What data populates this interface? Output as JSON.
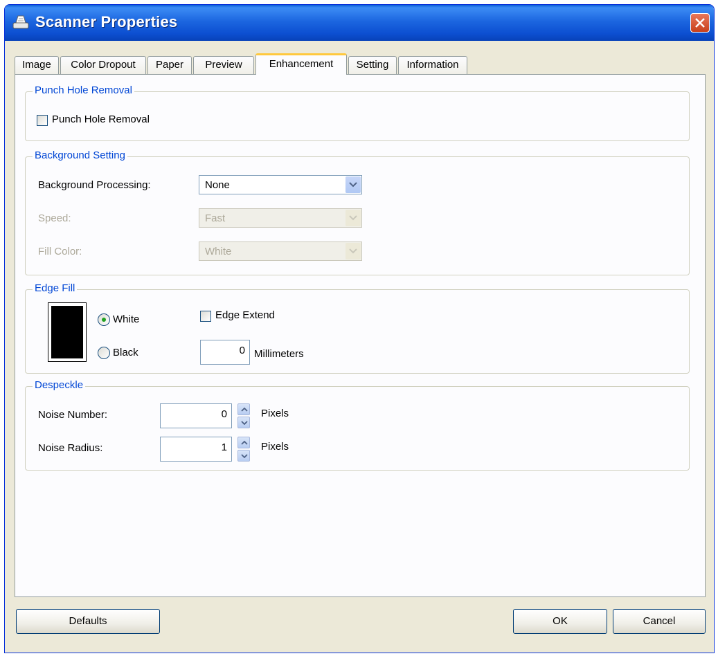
{
  "window": {
    "title": "Scanner Properties"
  },
  "tabs": [
    {
      "label": "Image"
    },
    {
      "label": "Color Dropout"
    },
    {
      "label": "Paper"
    },
    {
      "label": "Preview"
    },
    {
      "label": "Enhancement"
    },
    {
      "label": "Setting"
    },
    {
      "label": "Information"
    }
  ],
  "active_tab": "Enhancement",
  "punch_hole": {
    "legend": "Punch Hole Removal",
    "checkbox_label": "Punch Hole Removal",
    "checked": false
  },
  "background": {
    "legend": "Background Setting",
    "processing_label": "Background Processing:",
    "processing_value": "None",
    "speed_label": "Speed:",
    "speed_value": "Fast",
    "fill_color_label": "Fill Color:",
    "fill_color_value": "White"
  },
  "edge_fill": {
    "legend": "Edge Fill",
    "white_label": "White",
    "black_label": "Black",
    "selected": "White",
    "edge_extend_label": "Edge Extend",
    "edge_extend_checked": false,
    "millimeters_value": "0",
    "millimeters_label": "Millimeters"
  },
  "despeckle": {
    "legend": "Despeckle",
    "noise_number_label": "Noise Number:",
    "noise_number_value": "0",
    "noise_radius_label": "Noise Radius:",
    "noise_radius_value": "1",
    "unit": "Pixels"
  },
  "buttons": {
    "defaults": "Defaults",
    "ok": "OK",
    "cancel": "Cancel"
  }
}
